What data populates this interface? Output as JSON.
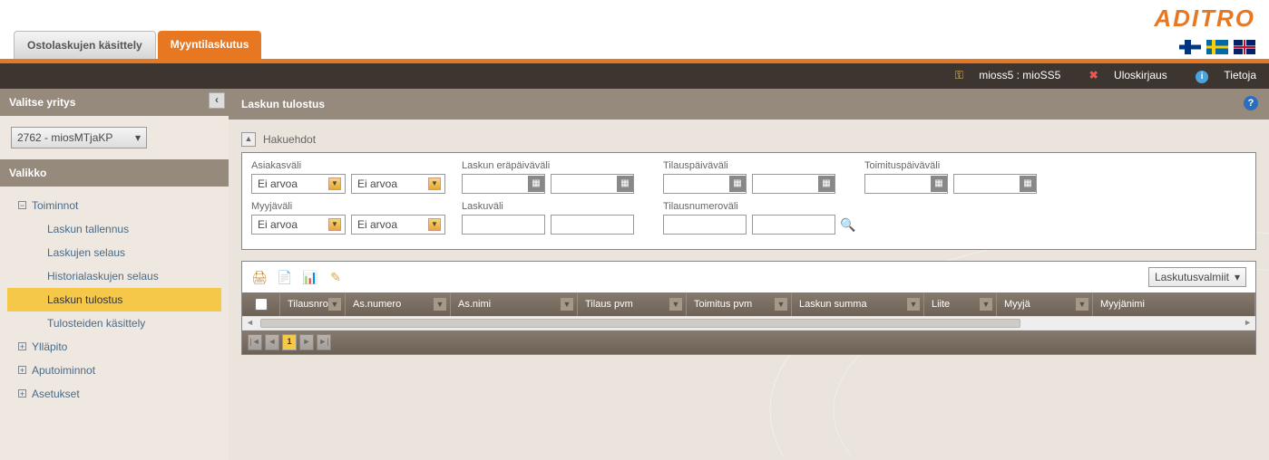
{
  "brand": "ADITRO",
  "tabs": {
    "inactive": "Ostolaskujen käsittely",
    "active": "Myyntilaskutus"
  },
  "userbar": {
    "user": "mioss5 : mioSS5",
    "logout": "Uloskirjaus",
    "info": "Tietoja"
  },
  "sidebar": {
    "company_header": "Valitse yritys",
    "company_value": "2762 - miosMTjaKP",
    "menu_header": "Valikko",
    "items": {
      "toiminnot": "Toiminnot",
      "laskun_tallennus": "Laskun tallennus",
      "laskujen_selaus": "Laskujen selaus",
      "historia": "Historialaskujen selaus",
      "laskun_tulostus": "Laskun tulostus",
      "tulosteiden": "Tulosteiden käsittely",
      "yllapito": "Ylläpito",
      "aputoiminnot": "Aputoiminnot",
      "asetukset": "Asetukset"
    }
  },
  "panel": {
    "title": "Laskun tulostus",
    "hakuehdot": "Hakuehdot",
    "labels": {
      "asiakasvali": "Asiakasväli",
      "laskun_erapaiva": "Laskun eräpäiväväli",
      "tilauspaiva": "Tilauspäiväväli",
      "toimituspaiva": "Toimituspäiväväli",
      "myyjavali": "Myyjäväli",
      "laskuvali": "Laskuväli",
      "tilausnumero": "Tilausnumeroväli"
    },
    "ei_arvoa": "Ei arvoa",
    "status_filter": "Laskutusvalmiit",
    "columns": {
      "tilausnro": "Tilausnro",
      "asnumero": "As.numero",
      "asnimi": "As.nimi",
      "tilauspvm": "Tilaus pvm",
      "toimituspvm": "Toimitus pvm",
      "laskunsumma": "Laskun summa",
      "liite": "Liite",
      "myyja": "Myyjä",
      "myyjanimi": "Myyjänimi"
    },
    "page": "1"
  }
}
